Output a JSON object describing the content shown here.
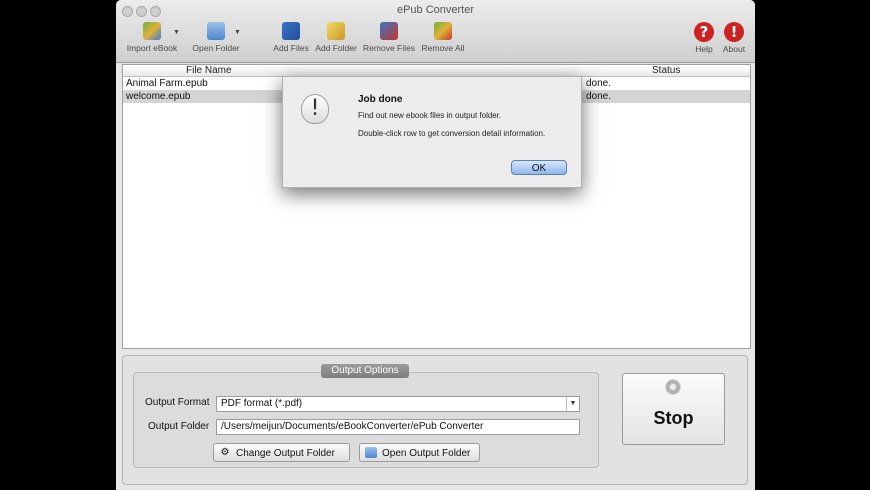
{
  "window": {
    "title": "ePub Converter"
  },
  "toolbar": {
    "import_ebook": "Import eBook",
    "open_folder": "Open Folder",
    "add_files": "Add Files",
    "add_folder": "Add Folder",
    "remove_files": "Remove Files",
    "remove_all": "Remove All",
    "help": "Help",
    "about": "About"
  },
  "table": {
    "columns": [
      "File Name",
      "Status"
    ],
    "rows": [
      {
        "file": "Animal Farm.epub",
        "status": "done."
      },
      {
        "file": "welcome.epub",
        "status": "done."
      }
    ]
  },
  "output_options": {
    "title": "Output Options",
    "format_label": "Output Format",
    "format_value": "PDF format (*.pdf)",
    "folder_label": "Output Folder",
    "folder_value": "/Users/meijun/Documents/eBookConverter/ePub Converter",
    "change_folder_button": "Change Output Folder",
    "open_folder_button": "Open Output Folder"
  },
  "stop_button": "Stop",
  "dialog": {
    "title": "Job done",
    "message1": "Find out new ebook files in output folder.",
    "message2": "Double-click row to get conversion detail information.",
    "ok": "OK"
  },
  "colors": {
    "accent_red": "#cc2222",
    "selection": "#d4d4d4",
    "ok_blue": "#8fb6ea"
  }
}
